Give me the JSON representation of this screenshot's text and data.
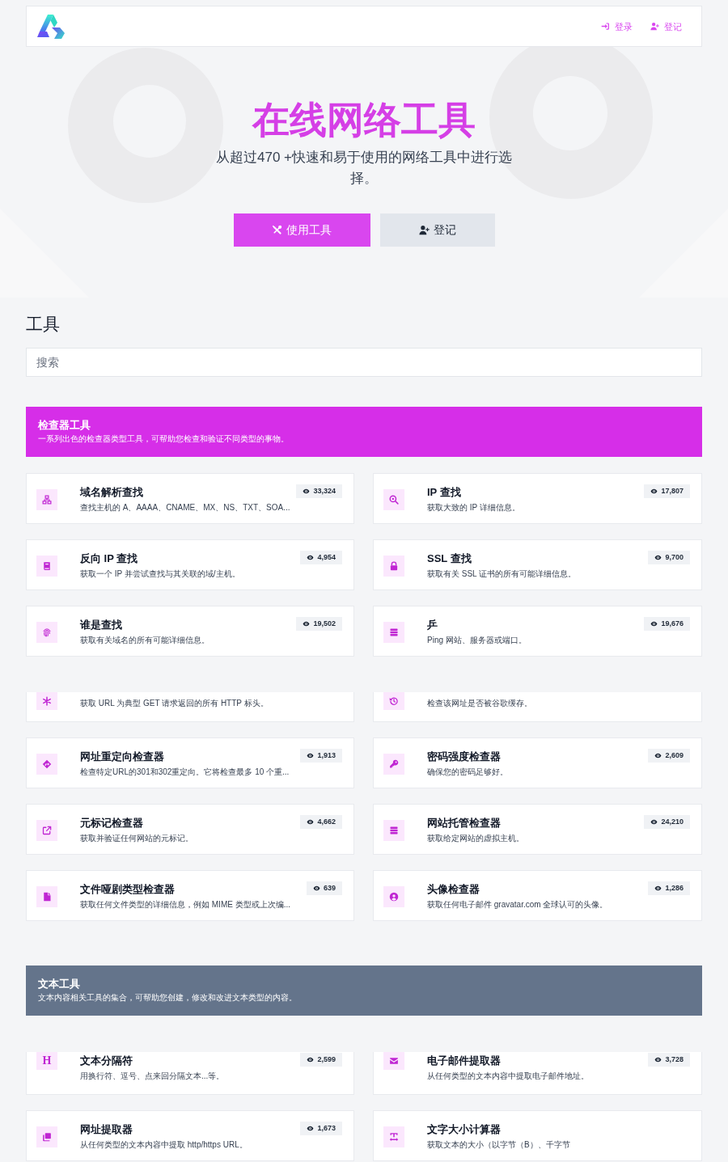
{
  "header": {
    "nav": [
      {
        "label": "登录"
      },
      {
        "label": "登记"
      }
    ]
  },
  "hero": {
    "title": "在线网络工具",
    "subtitle": "从超过470 +快速和易于使用的网络工具中进行选择。",
    "buttons": [
      {
        "label": "使用工具",
        "kind": "primary"
      },
      {
        "label": "登记",
        "kind": "secondary"
      }
    ]
  },
  "tools": {
    "heading": "工具",
    "search": {
      "placeholder": "搜索"
    }
  },
  "sections": [
    {
      "title": "检查器工具",
      "description": "一系列出色的检查器类型工具，可帮助您检查和验证不同类型的事物。",
      "color": "#d62ee8",
      "cards": [
        {
          "kind": "full",
          "title": "域名解析查找",
          "description": "查找主机的 A、AAAA、CNAME、MX、NS、TXT、SOA...",
          "views": "33,324"
        },
        {
          "kind": "full",
          "title": "IP 查找",
          "description": "获取大致的 IP 详细信息。",
          "views": "17,807"
        },
        {
          "kind": "full",
          "title": "反向 IP 查找",
          "description": "获取一个 IP 并尝试查找与其关联的域/主机。",
          "views": "4,954"
        },
        {
          "kind": "full",
          "title": "SSL 查找",
          "description": "获取有关 SSL 证书的所有可能详细信息。",
          "views": "9,700"
        },
        {
          "kind": "full",
          "title": "谁是查找",
          "description": "获取有关域名的所有可能详细信息。",
          "views": "19,502"
        },
        {
          "kind": "full",
          "title": "乒",
          "description": "Ping 网站、服务器或端口。",
          "views": "19,676"
        },
        {
          "kind": "cut",
          "description": "获取 URL 为典型 GET 请求返回的所有 HTTP 标头。"
        },
        {
          "kind": "cut",
          "description": "检查该网址是否被谷歌缓存。"
        },
        {
          "kind": "full",
          "title": "网址重定向检查器",
          "description": "检查特定URL的301和302重定向。它将检查最多 10 个重...",
          "views": "1,913"
        },
        {
          "kind": "full",
          "title": "密码强度检查器",
          "description": "确保您的密码足够好。",
          "views": "2,609"
        },
        {
          "kind": "full",
          "title": "元标记检查器",
          "description": "获取并验证任何网站的元标记。",
          "views": "4,662"
        },
        {
          "kind": "full",
          "title": "网站托管检查器",
          "description": "获取给定网站的虚拟主机。",
          "views": "24,210"
        },
        {
          "kind": "full",
          "title": "文件哑剧类型检查器",
          "description": "获取任何文件类型的详细信息，例如 MIME 类型或上次编...",
          "views": "639"
        },
        {
          "kind": "full",
          "title": "头像检查器",
          "description": "获取任何电子邮件 gravatar.com 全球认可的头像。",
          "views": "1,286"
        }
      ]
    },
    {
      "title": "文本工具",
      "description": "文本内容相关工具的集合，可帮助您创建，修改和改进文本类型的内容。",
      "color": "#64748b",
      "cards": [
        {
          "kind": "cut",
          "glyph": "H",
          "title": "文本分隔符",
          "description": "用换行符、逗号、点来回分隔文本...等。",
          "views": "2,599"
        },
        {
          "kind": "cut",
          "title": "电子邮件提取器",
          "description": "从任何类型的文本内容中提取电子邮件地址。",
          "views": "3,728"
        },
        {
          "kind": "full",
          "title": "网址提取器",
          "description": "从任何类型的文本内容中提取 http/https URL。",
          "views": "1,673"
        },
        {
          "kind": "full",
          "title": "文字大小计算器",
          "description": "获取文本的大小（以字节（B）、千字节"
        }
      ]
    }
  ]
}
